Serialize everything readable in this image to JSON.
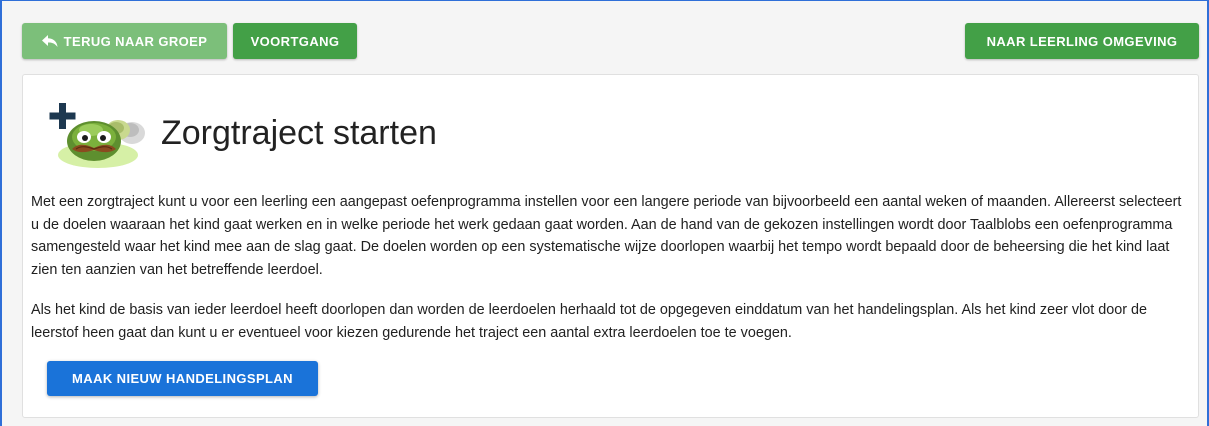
{
  "toolbar": {
    "back_label": "TERUG NAAR GROEP",
    "progress_label": "VOORTGANG",
    "student_env_label": "NAAR LEERLING OMGEVING"
  },
  "card": {
    "title": "Zorgtraject starten",
    "intro": "Met een zorgtraject kunt u voor een leerling een aangepast oefenprogramma instellen voor een langere periode van bijvoorbeeld een aantal weken of maanden. Allereerst selecteert u de doelen waaraan het kind gaat werken en in welke periode het werk gedaan gaat worden. Aan de hand van de gekozen instellingen wordt door Taalblobs een oefenprogramma samengesteld waar het kind mee aan de slag gaat. De doelen worden op een systematische wijze doorlopen waarbij het tempo wordt bepaald door de beheersing die het kind laat zien ten aanzien van het betreffende leerdoel.",
    "repeat_info": "Als het kind de basis van ieder leerdoel heeft doorlopen dan worden de leerdoelen herhaald tot de opgegeven einddatum van het handelingsplan. Als het kind zeer vlot door de leerstof heen gaat dan kunt u er eventueel voor kiezen gedurende het traject een aantal extra leerdoelen toe te voegen.",
    "create_plan_label": "MAAK NIEUW HANDELINGSPLAN"
  },
  "icons": {
    "back": "reply-arrow-icon",
    "logo": "taalblob-plus-logo"
  },
  "colors": {
    "green": "#43a047",
    "green_light": "#7cbf7a",
    "blue": "#1a73d9",
    "frame_border": "#2f6fd8"
  }
}
